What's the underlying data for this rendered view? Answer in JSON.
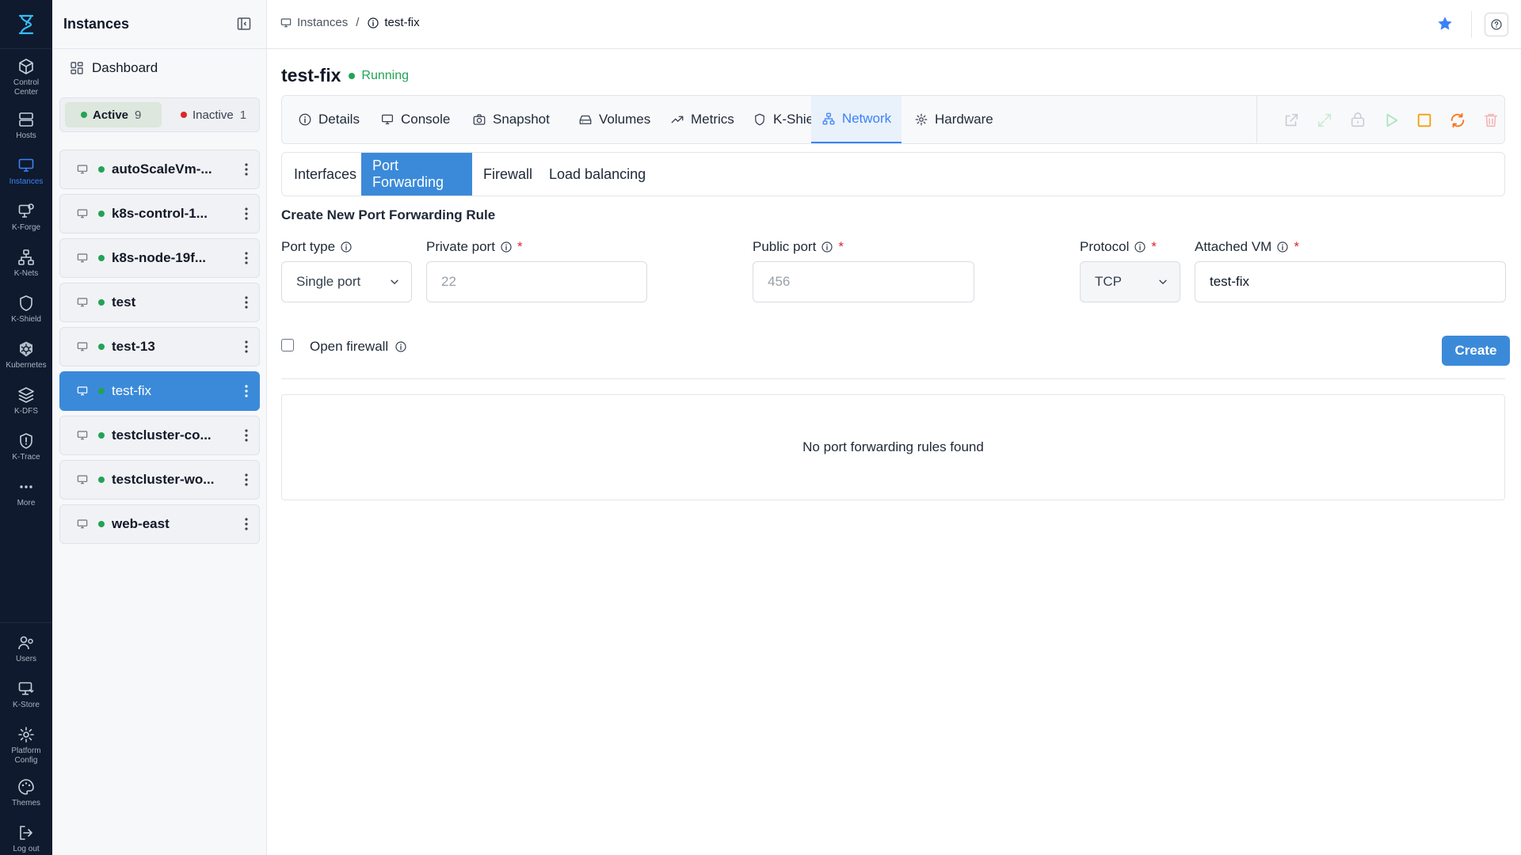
{
  "rail": {
    "items": [
      {
        "label_l1": "Control",
        "label_l2": "Center",
        "icon": "cube-icon"
      },
      {
        "label_l1": "Hosts",
        "label_l2": "",
        "icon": "server-icon"
      },
      {
        "label_l1": "Instances",
        "label_l2": "",
        "icon": "monitor-icon"
      },
      {
        "label_l1": "K-Forge",
        "label_l2": "",
        "icon": "forge-icon"
      },
      {
        "label_l1": "K-Nets",
        "label_l2": "",
        "icon": "network-icon"
      },
      {
        "label_l1": "K-Shield",
        "label_l2": "",
        "icon": "shield-icon"
      },
      {
        "label_l1": "Kubernetes",
        "label_l2": "",
        "icon": "kubernetes-icon"
      },
      {
        "label_l1": "K-DFS",
        "label_l2": "",
        "icon": "layers-icon"
      },
      {
        "label_l1": "K-Trace",
        "label_l2": "",
        "icon": "trace-shield-icon"
      },
      {
        "label_l1": "More",
        "label_l2": "",
        "icon": "more-dots-icon"
      }
    ],
    "bottom": [
      {
        "label_l1": "Users",
        "label_l2": "",
        "icon": "users-icon"
      },
      {
        "label_l1": "K-Store",
        "label_l2": "",
        "icon": "store-icon"
      },
      {
        "label_l1": "Platform",
        "label_l2": "Config",
        "icon": "gear-icon"
      },
      {
        "label_l1": "Themes",
        "label_l2": "",
        "icon": "palette-icon"
      },
      {
        "label_l1": "Log out",
        "label_l2": "",
        "icon": "logout-icon"
      }
    ],
    "active_color": "#3b82f6"
  },
  "panel": {
    "title": "Instances",
    "dashboard": "Dashboard",
    "filter": {
      "active_label": "Active",
      "active_count": "9",
      "inactive_label": "Inactive",
      "inactive_count": "1",
      "active_color": "#22a355",
      "inactive_color": "#dc2626"
    },
    "instances": [
      "autoScaleVm-...",
      "k8s-control-1...",
      "k8s-node-19f...",
      "test",
      "test-13",
      "test-fix",
      "testcluster-co...",
      "testcluster-wo...",
      "web-east"
    ],
    "selected": "test-fix"
  },
  "breadcrumb": {
    "root": "Instances",
    "separator": "/",
    "current": "test-fix"
  },
  "vm": {
    "name": "test-fix",
    "status": "Running",
    "status_color": "#22a355"
  },
  "tabs": [
    {
      "label": "Details",
      "icon": "info-icon"
    },
    {
      "label": "Console",
      "icon": "monitor-icon"
    },
    {
      "label": "Snapshot",
      "icon": "camera-icon"
    },
    {
      "label": "Volumes",
      "icon": "drive-icon"
    },
    {
      "label": "Metrics",
      "icon": "trend-icon"
    },
    {
      "label": "K-Shield",
      "icon": "shield-icon"
    },
    {
      "label": "Network",
      "icon": "network-icon"
    },
    {
      "label": "Hardware",
      "icon": "gear-icon"
    }
  ],
  "active_tab": "Network",
  "subtabs": [
    "Interfaces",
    "Port Forwarding",
    "Firewall",
    "Load balancing"
  ],
  "active_subtab": "Port Forwarding",
  "form": {
    "section_title": "Create New Port Forwarding Rule",
    "port_type_label": "Port type",
    "port_type_value": "Single port",
    "private_port_label": "Private port",
    "private_port_placeholder": "22",
    "public_port_label": "Public port",
    "public_port_placeholder": "456",
    "protocol_label": "Protocol",
    "protocol_value": "TCP",
    "attached_vm_label": "Attached VM",
    "attached_vm_value": "test-fix",
    "required_mark": "*",
    "open_firewall_label": "Open firewall",
    "create_label": "Create"
  },
  "empty_message": "No port forwarding rules found"
}
